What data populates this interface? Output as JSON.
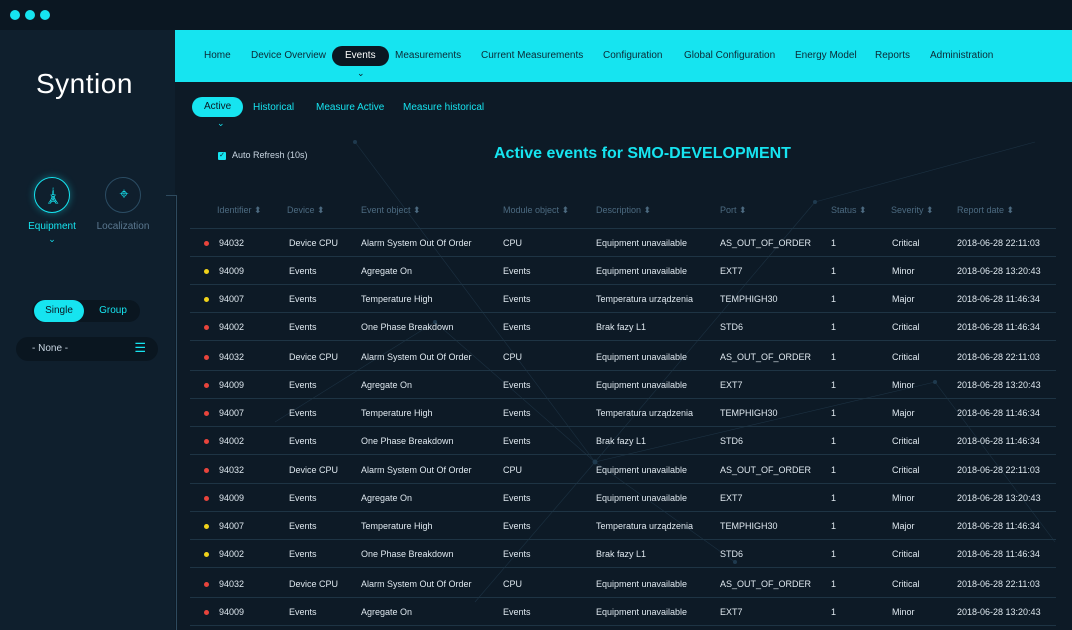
{
  "app": {
    "logo": "Syntion"
  },
  "colors": {
    "accent": "#16e4f0",
    "background": "#0d1a26",
    "critical": "#e8443c",
    "minor": "#f0d21a",
    "major": "#f0d21a"
  },
  "sidebar": {
    "tabs": [
      {
        "label": "Equipment",
        "icon": "tower-icon"
      },
      {
        "label": "Localization",
        "icon": "location-pin-icon"
      }
    ],
    "toggle": {
      "single": "Single",
      "group": "Group"
    },
    "dropdown": {
      "value": "- None -"
    }
  },
  "nav": {
    "items": [
      "Home",
      "Device Overview",
      "Events",
      "Measurements",
      "Current Measurements",
      "Configuration",
      "Global Configuration",
      "Energy Model",
      "Reports",
      "Administration"
    ]
  },
  "subnav": {
    "items": [
      "Active",
      "Historical",
      "Measure Active",
      "Measure historical"
    ]
  },
  "auto_refresh": "Auto Refresh (10s)",
  "page_title": "Active events for SMO-DEVELOPMENT",
  "table": {
    "headers": [
      "Identifier",
      "Device",
      "Event object",
      "Module object",
      "Description",
      "Port",
      "Status",
      "Severity",
      "Report date"
    ],
    "rows": [
      {
        "sev": "critical",
        "cells": [
          "94032",
          "Device CPU",
          "Alarm System Out Of Order",
          "CPU",
          "Equipment unavailable",
          "AS_OUT_OF_ORDER",
          "1",
          "Critical",
          "2018-06-28 22:11:03"
        ]
      },
      {
        "sev": "minor",
        "cells": [
          "94009",
          "Events",
          "Agregate On",
          "Events",
          "Equipment unavailable",
          "EXT7",
          "1",
          "Minor",
          "2018-06-28 13:20:43"
        ]
      },
      {
        "sev": "major",
        "cells": [
          "94007",
          "Events",
          "Temperature High",
          "Events",
          "Temperatura urządzenia",
          "TEMPHIGH30",
          "1",
          "Major",
          "2018-06-28 11:46:34"
        ]
      },
      {
        "sev": "critical",
        "cells": [
          "94002",
          "Events",
          "One Phase Breakdown",
          "Events",
          "Brak fazy L1",
          "STD6",
          "1",
          "Critical",
          "2018-06-28 11:46:34"
        ]
      },
      {
        "sev": "critical",
        "cells": [
          "94032",
          "Device CPU",
          "Alarm System Out Of Order",
          "CPU",
          "Equipment unavailable",
          "AS_OUT_OF_ORDER",
          "1",
          "Critical",
          "2018-06-28 22:11:03"
        ]
      },
      {
        "sev": "critical",
        "cells": [
          "94009",
          "Events",
          "Agregate On",
          "Events",
          "Equipment unavailable",
          "EXT7",
          "1",
          "Minor",
          "2018-06-28 13:20:43"
        ]
      },
      {
        "sev": "critical",
        "cells": [
          "94007",
          "Events",
          "Temperature High",
          "Events",
          "Temperatura urządzenia",
          "TEMPHIGH30",
          "1",
          "Major",
          "2018-06-28 11:46:34"
        ]
      },
      {
        "sev": "critical",
        "cells": [
          "94002",
          "Events",
          "One Phase Breakdown",
          "Events",
          "Brak fazy L1",
          "STD6",
          "1",
          "Critical",
          "2018-06-28 11:46:34"
        ]
      },
      {
        "sev": "critical",
        "cells": [
          "94032",
          "Device CPU",
          "Alarm System Out Of Order",
          "CPU",
          "Equipment unavailable",
          "AS_OUT_OF_ORDER",
          "1",
          "Critical",
          "2018-06-28 22:11:03"
        ]
      },
      {
        "sev": "critical",
        "cells": [
          "94009",
          "Events",
          "Agregate On",
          "Events",
          "Equipment unavailable",
          "EXT7",
          "1",
          "Minor",
          "2018-06-28 13:20:43"
        ]
      },
      {
        "sev": "major",
        "cells": [
          "94007",
          "Events",
          "Temperature High",
          "Events",
          "Temperatura urządzenia",
          "TEMPHIGH30",
          "1",
          "Major",
          "2018-06-28 11:46:34"
        ]
      },
      {
        "sev": "major",
        "cells": [
          "94002",
          "Events",
          "One Phase Breakdown",
          "Events",
          "Brak fazy L1",
          "STD6",
          "1",
          "Critical",
          "2018-06-28 11:46:34"
        ]
      },
      {
        "sev": "critical",
        "cells": [
          "94032",
          "Device CPU",
          "Alarm System Out Of Order",
          "CPU",
          "Equipment unavailable",
          "AS_OUT_OF_ORDER",
          "1",
          "Critical",
          "2018-06-28 22:11:03"
        ]
      },
      {
        "sev": "critical",
        "cells": [
          "94009",
          "Events",
          "Agregate On",
          "Events",
          "Equipment unavailable",
          "EXT7",
          "1",
          "Minor",
          "2018-06-28 13:20:43"
        ]
      }
    ]
  }
}
